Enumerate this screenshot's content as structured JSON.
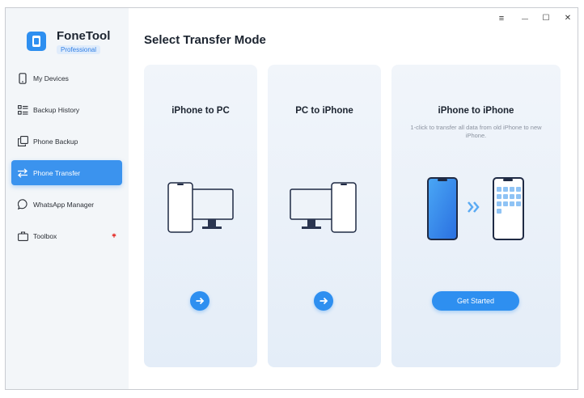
{
  "app": {
    "name": "FoneTool",
    "edition": "Professional"
  },
  "window_controls": {
    "menu": "≡",
    "minimize": "—",
    "maximize": "☐",
    "close": "✕"
  },
  "sidebar": {
    "items": [
      {
        "label": "My Devices",
        "icon": "phone-icon"
      },
      {
        "label": "Backup History",
        "icon": "list-icon"
      },
      {
        "label": "Phone Backup",
        "icon": "copy-icon"
      },
      {
        "label": "Phone Transfer",
        "icon": "transfer-arrows-icon",
        "active": true
      },
      {
        "label": "WhatsApp Manager",
        "icon": "chat-bubble-icon"
      },
      {
        "label": "Toolbox",
        "icon": "briefcase-icon"
      }
    ]
  },
  "main": {
    "title": "Select Transfer Mode",
    "cards": [
      {
        "title": "iPhone to PC"
      },
      {
        "title": "PC to iPhone"
      },
      {
        "title": "iPhone to iPhone",
        "description": "1-click to transfer all data from old iPhone to new iPhone.",
        "button_label": "Get Started"
      }
    ]
  },
  "colors": {
    "accent": "#2e8ff0",
    "sidebar_bg": "#f3f6f9",
    "card_bg": "#e8eff8"
  }
}
